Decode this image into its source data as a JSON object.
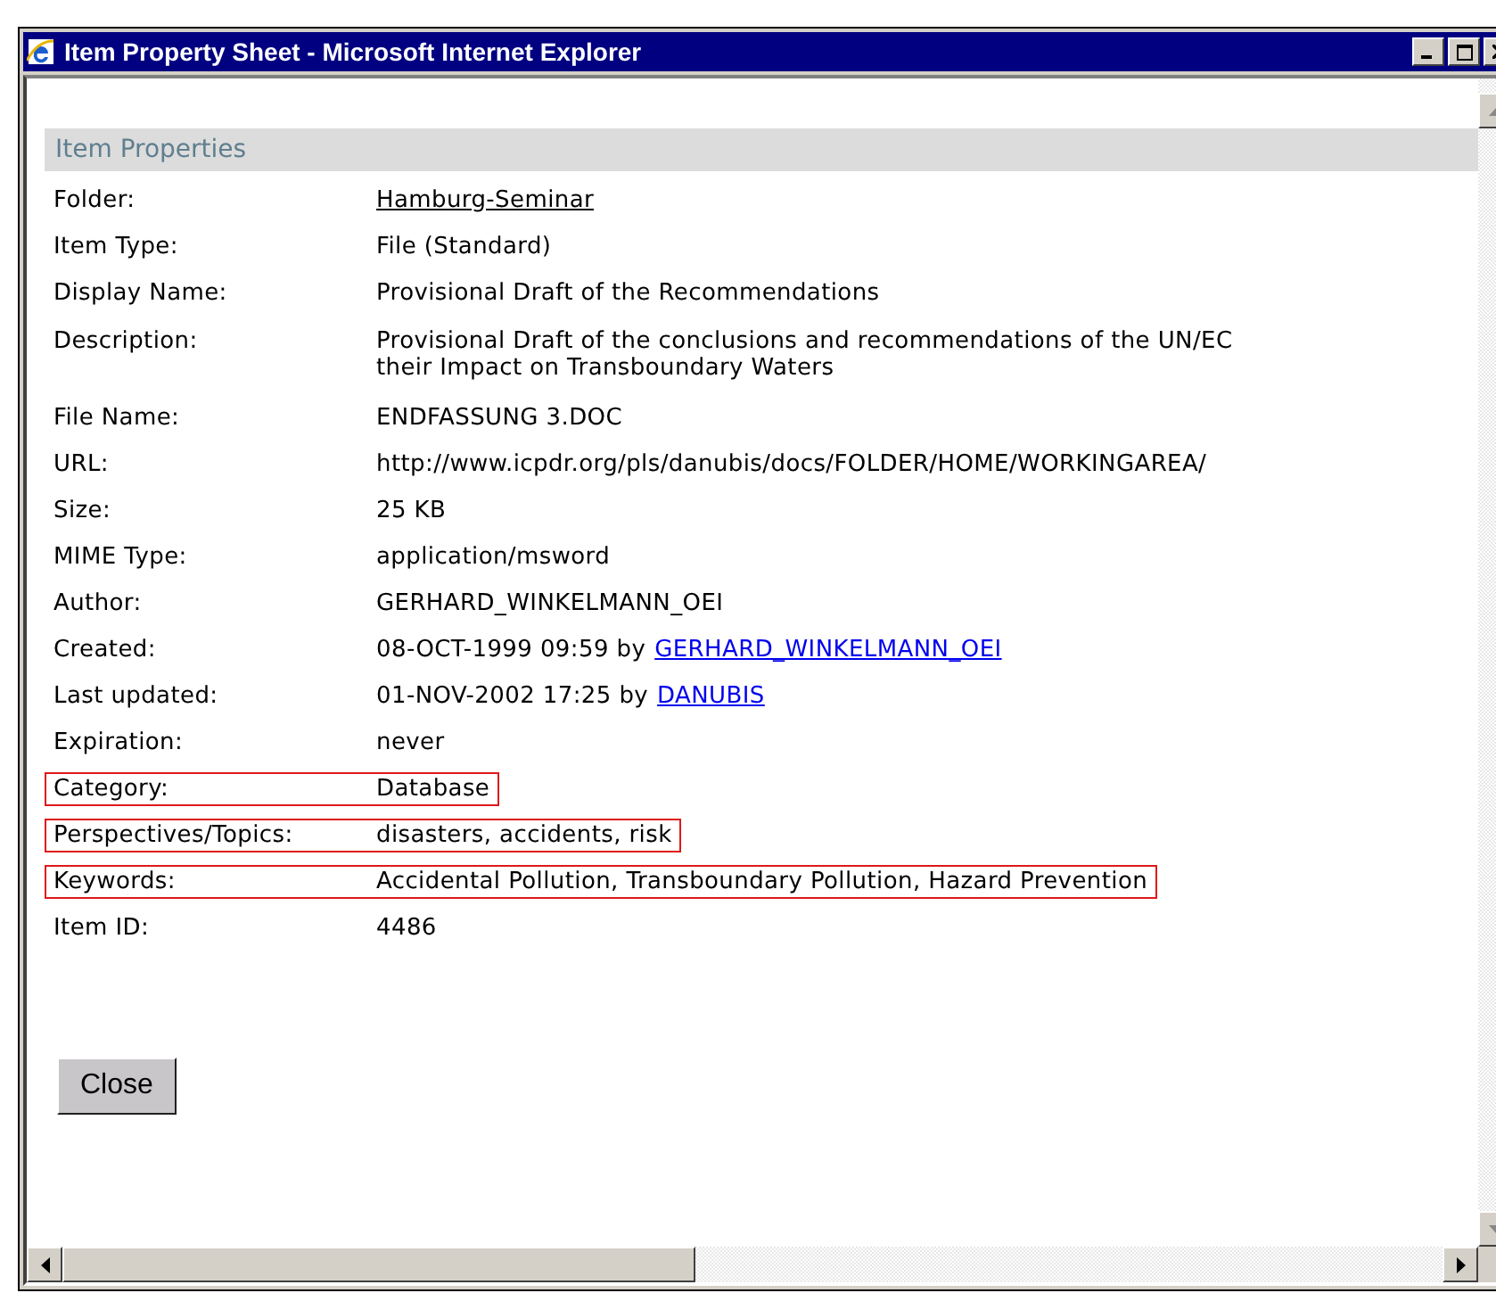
{
  "window": {
    "title": "Item Property Sheet - Microsoft Internet Explorer"
  },
  "section": {
    "title": "Item Properties"
  },
  "rows": [
    {
      "label": "Folder:",
      "link": "Hamburg-Seminar",
      "link_visited": true,
      "highlighted": false
    },
    {
      "label": "Item Type:",
      "value": "File (Standard)",
      "highlighted": false
    },
    {
      "label": "Display Name:",
      "value": "Provisional Draft of the Recommendations",
      "highlighted": false
    },
    {
      "label": "Description:",
      "lines": [
        "Provisional Draft of the conclusions and recommendations of the UN/EC",
        "their Impact on Transboundary Waters"
      ],
      "highlighted": false
    },
    {
      "label": "File Name:",
      "value": "ENDFASSUNG 3.DOC",
      "highlighted": false
    },
    {
      "label": "URL:",
      "value": "http://www.icpdr.org/pls/danubis/docs/FOLDER/HOME/WORKINGAREA/",
      "highlighted": false
    },
    {
      "label": "Size:",
      "value": "25 KB",
      "highlighted": false
    },
    {
      "label": "MIME Type:",
      "value": "application/msword",
      "highlighted": false
    },
    {
      "label": "Author:",
      "value": "GERHARD_WINKELMANN_OEI",
      "highlighted": false
    },
    {
      "label": "Created:",
      "value": "08-OCT-1999 09:59 by",
      "link": "GERHARD_WINKELMANN_OEI",
      "link_visited": false,
      "highlighted": false
    },
    {
      "label": "Last updated:",
      "value": "01-NOV-2002 17:25 by",
      "link": "DANUBIS",
      "link_visited": false,
      "highlighted": false
    },
    {
      "label": "Expiration:",
      "value": "never",
      "highlighted": false
    },
    {
      "label": "Category:",
      "value": "Database",
      "highlighted": true
    },
    {
      "label": "Perspectives/Topics:",
      "value": "disasters, accidents, risk",
      "highlighted": true
    },
    {
      "label": "Keywords:",
      "value": "Accidental Pollution, Transboundary Pollution, Hazard Prevention",
      "highlighted": true
    },
    {
      "label": "Item ID:",
      "value": "4486",
      "highlighted": false
    }
  ],
  "buttons": [
    "Close"
  ]
}
